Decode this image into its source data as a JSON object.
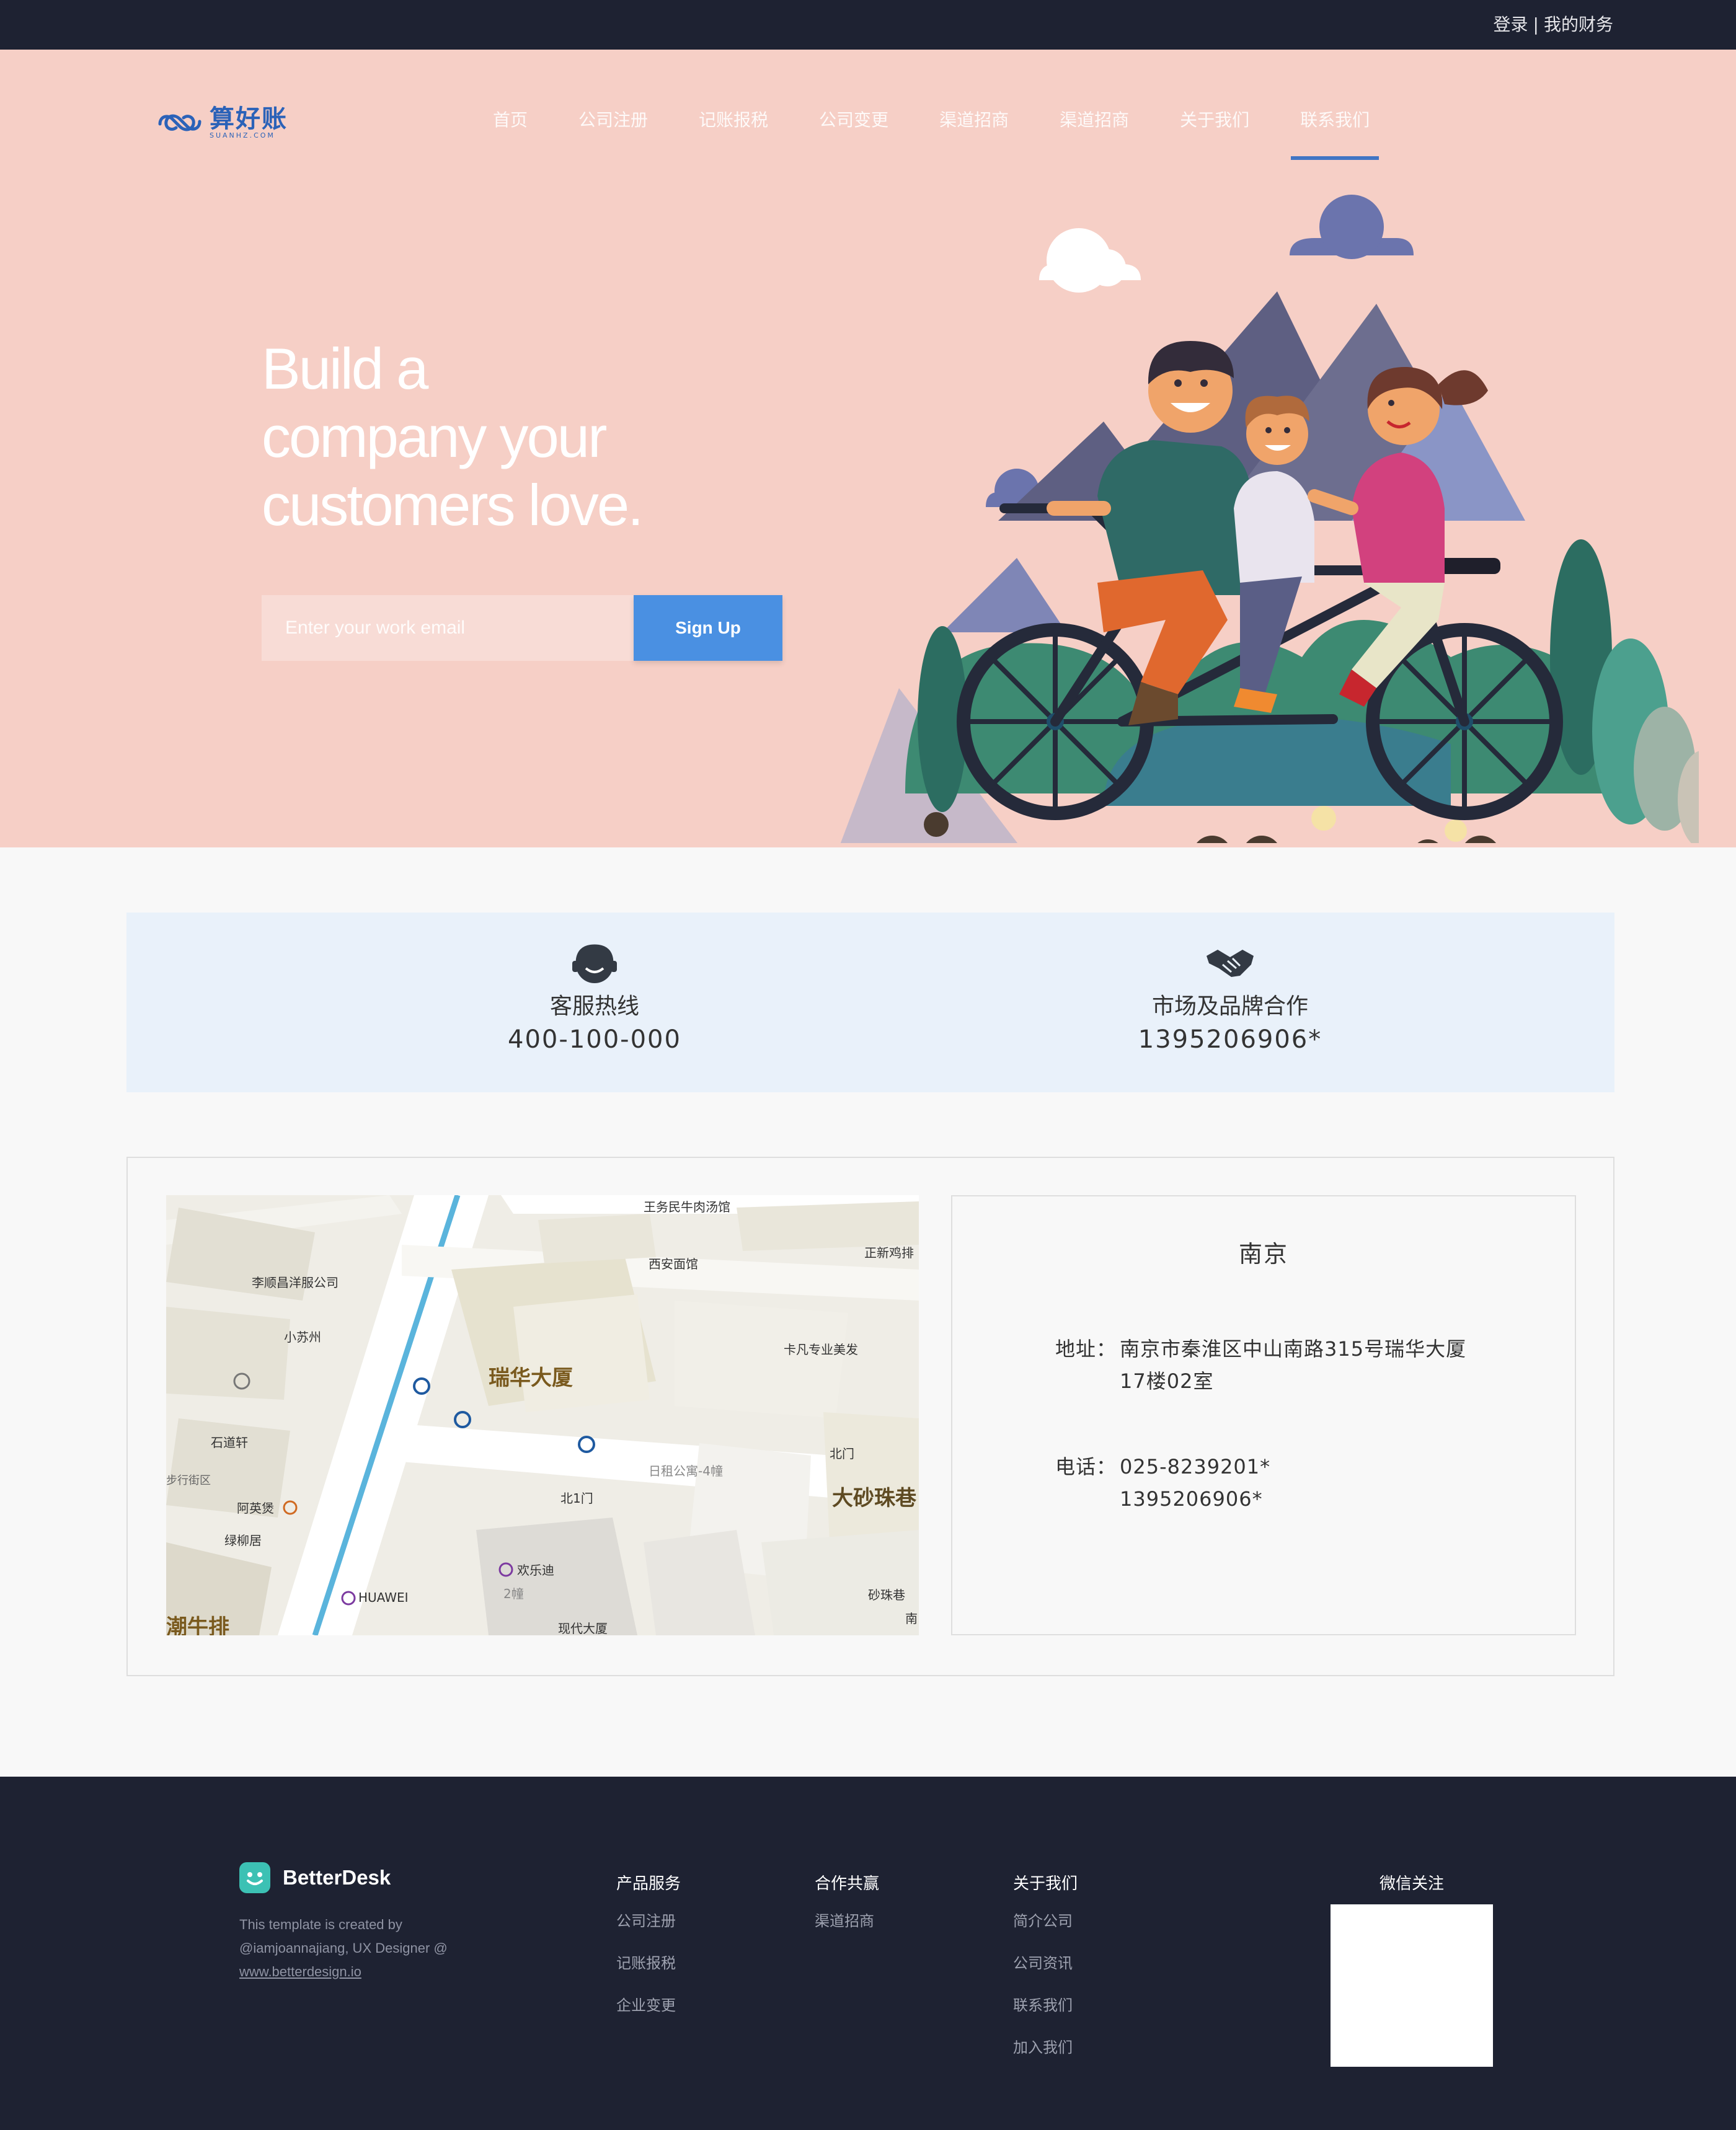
{
  "topbar": {
    "login": "登录",
    "separator": "|",
    "finance": "我的财务"
  },
  "logo": {
    "name": "算好账",
    "sub": "SUANHZ.COM"
  },
  "nav": {
    "items": [
      {
        "label": "首页"
      },
      {
        "label": "公司注册"
      },
      {
        "label": "记账报税"
      },
      {
        "label": "公司变更"
      },
      {
        "label": "渠道招商"
      },
      {
        "label": "渠道招商"
      },
      {
        "label": "关于我们"
      },
      {
        "label": "联系我们"
      }
    ],
    "active_index": 7
  },
  "hero": {
    "title_lines": [
      "Build a",
      "company your",
      "customers love."
    ],
    "email_placeholder": "Enter your work email",
    "signup_label": "Sign Up"
  },
  "contact": {
    "hotline_label": "客服热线",
    "hotline_value": "400-100-000",
    "market_label": "市场及品牌合作",
    "market_value": "1395206906*"
  },
  "map": {
    "labels": {
      "p1": "王务民牛肉汤馆",
      "p2": "西安面馆",
      "p3": "正新鸡排",
      "p4": "李顺昌洋服公司",
      "p5": "小苏州",
      "p6": "卡凡专业美发",
      "p7": "瑞华大厦",
      "p8": "石道轩",
      "p9": "北门",
      "p10": "日租公寓-4幢",
      "p11": "北1门",
      "p12": "大砂珠巷",
      "p13": "阿英煲",
      "p14": "绿柳居",
      "p15": "欢乐迪",
      "p16": "2幢",
      "p17": "HUAWEI",
      "p18": "砂珠巷",
      "p19": "现代大厦",
      "p20": "潮牛排",
      "p21": "步行街区",
      "p22": "南"
    }
  },
  "address": {
    "city": "南京",
    "addr_key": "地址：",
    "addr_line1": "南京市秦淮区中山南路315号瑞华大厦",
    "addr_line2": "17楼02室",
    "tel_key": "电话：",
    "tel_line1": "025-8239201*",
    "tel_line2": "1395206906*"
  },
  "footer": {
    "brand": "BetterDesk",
    "credit_line1": "This template is created by",
    "credit_line2": "@iamjoannajiang, UX Designer @",
    "credit_link": "www.betterdesign.io",
    "col1": {
      "head": "产品服务",
      "items": [
        "公司注册",
        "记账报税",
        "企业变更"
      ]
    },
    "col2": {
      "head": "合作共赢",
      "items": [
        "渠道招商"
      ]
    },
    "col3": {
      "head": "关于我们",
      "items": [
        "简介公司",
        "公司资讯",
        "联系我们",
        "加入我们"
      ]
    },
    "wechat": "微信关注"
  },
  "colors": {
    "topbar": "#1e2232",
    "hero_bg": "#f6cfc6",
    "accent": "#2d6bc4",
    "button": "#4a90e2",
    "contact_bg": "#e9f1fa",
    "brand_icon": "#3cc1b4"
  }
}
